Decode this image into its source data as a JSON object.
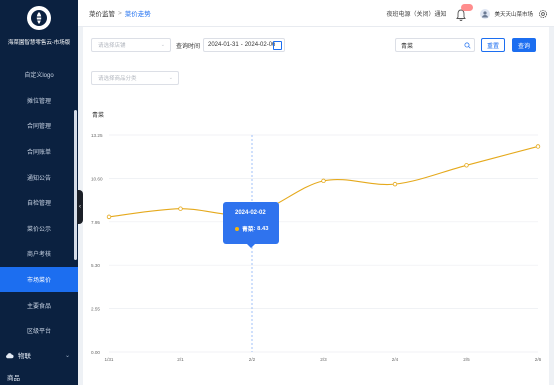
{
  "brand": {
    "title": "海菜園智慧零售云-市场版"
  },
  "sidebar": {
    "items": [
      {
        "label": "自定义logo"
      },
      {
        "label": "摊位管理"
      },
      {
        "label": "合同管理"
      },
      {
        "label": "合同账单"
      },
      {
        "label": "通知公告"
      },
      {
        "label": "自检管理"
      },
      {
        "label": "菜价公示"
      },
      {
        "label": "商户考核"
      },
      {
        "label": "市场菜价"
      },
      {
        "label": "主要食品"
      },
      {
        "label": "区级平台"
      }
    ],
    "active_index": 8,
    "group": {
      "label": "物联"
    },
    "group2": {
      "label": "商品"
    }
  },
  "header": {
    "breadcrumb_parent": "菜价监管",
    "breadcrumb_sep": ">",
    "breadcrumb_current": "菜价走势",
    "hotline": "夜班电源（关闭）通知",
    "username": "美天天山菜市场"
  },
  "filters": {
    "market_placeholder": "请选择店铺",
    "query_time_label": "查询时间",
    "date_start": "2024-01-31",
    "date_end": "2024-02-06",
    "date_sep": "-",
    "category_placeholder": "请选择商品分类",
    "search_value": "青菜",
    "reset_label": "重置",
    "query_label": "查询"
  },
  "tooltip": {
    "date": "2024-02-02",
    "series": "青菜",
    "value": "8.43"
  },
  "colors": {
    "accent": "#1c6ef0",
    "line": "#e5a91c",
    "sidebar": "#0b2140"
  },
  "chart_data": {
    "type": "line",
    "title": "青菜",
    "x": [
      "1/31",
      "2/1",
      "2/2",
      "2/3",
      "2/4",
      "2/5",
      "2/6"
    ],
    "series": [
      {
        "name": "青菜",
        "values": [
          8.25,
          8.75,
          8.43,
          10.45,
          10.25,
          11.4,
          12.55
        ]
      }
    ],
    "y_ticks": [
      "0.00",
      "2.55",
      "5.30",
      "7.95",
      "10.60",
      "13.25"
    ],
    "ylim": [
      0,
      13.25
    ],
    "highlight_index": 2,
    "grid": true
  }
}
